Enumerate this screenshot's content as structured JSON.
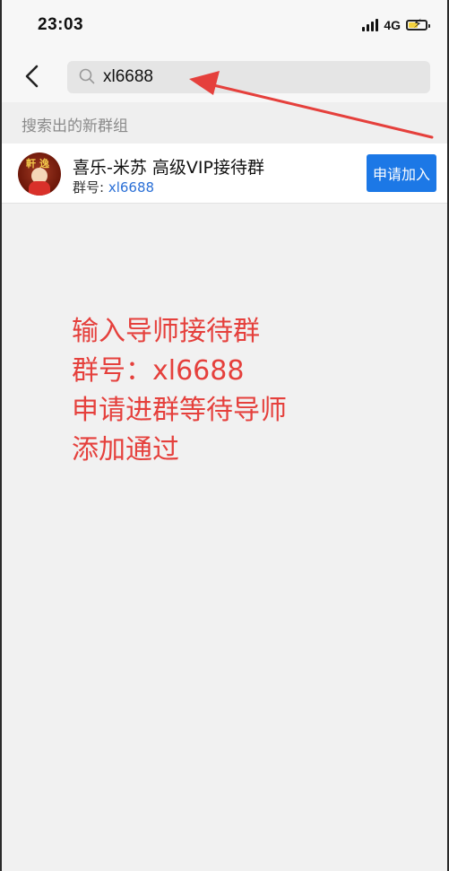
{
  "status_bar": {
    "time": "23:03",
    "network": "4G"
  },
  "header": {
    "back_icon": "chevron-left-icon",
    "search": {
      "value": "xl6688",
      "icon": "search-icon"
    }
  },
  "section": {
    "title": "搜索出的新群组"
  },
  "group_result": {
    "name": "喜乐-米苏 高级VIP接待群",
    "id_label": "群号: ",
    "id_value": "xl6688",
    "join_label": "申请加入",
    "avatar_text": "軒逸"
  },
  "annotation": {
    "lines": [
      "输入导师接待群",
      "群号：xl6688",
      "申请进群等待导师",
      "添加通过"
    ],
    "color": "#e5403c"
  },
  "colors": {
    "join_button": "#1c78e6",
    "group_id": "#2a6fd6",
    "arrow": "#e5403c"
  }
}
